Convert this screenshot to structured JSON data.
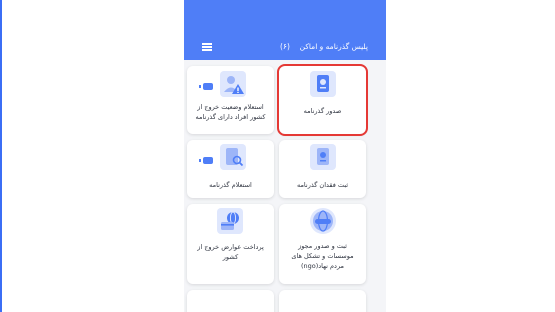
{
  "header": {
    "title": "پلیس گذرنامه و اماکن",
    "count": "(۶)"
  },
  "cards": [
    {
      "label": "صدور گذرنامه",
      "icon": "passport-icon",
      "highlighted": true
    },
    {
      "label": "استعلام وضعیت خروج از کشور افراد دارای گذرنامه",
      "icon": "user-warning-icon"
    },
    {
      "label": "ثبت فقدان گذرنامه",
      "icon": "passport-loss-icon"
    },
    {
      "label": "استعلام گذرنامه",
      "icon": "passport-search-icon"
    },
    {
      "label": "ثبت و صدور مجوز موسسات و تشکل های مردم نهاد(ngo)",
      "icon": "globe-handshake-icon"
    },
    {
      "label": "پرداخت عوارض خروج از کشور",
      "icon": "payment-globe-icon"
    }
  ],
  "colors": {
    "header": "#4f7ef7",
    "icon_bg": "#dfe7fd",
    "highlight": "#e53935"
  }
}
